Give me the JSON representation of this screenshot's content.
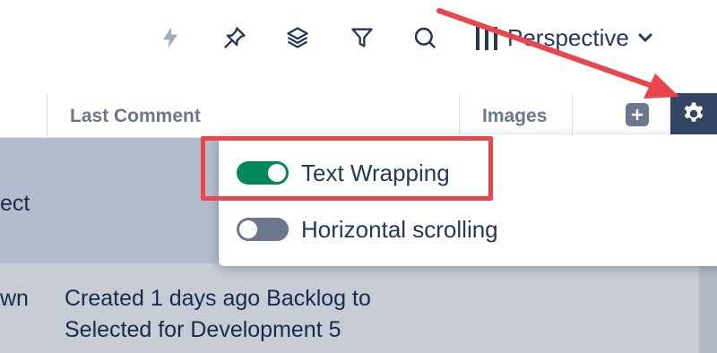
{
  "toolbar": {
    "icons": [
      "lightning-icon",
      "pin-icon",
      "layers-icon",
      "filter-icon",
      "search-icon"
    ],
    "perspective_label": "Perspective"
  },
  "table": {
    "headers": {
      "last_comment": "Last Comment",
      "images": "Images"
    },
    "rows": [
      {
        "left_fragment": "ect",
        "last_comment": ""
      },
      {
        "left_fragment": "wn",
        "last_comment": "Created 1 days ago Backlog to Selected for Development 5"
      }
    ]
  },
  "settings_menu": {
    "options": [
      {
        "label": "Text Wrapping",
        "enabled": true
      },
      {
        "label": "Horizontal scrolling",
        "enabled": false
      }
    ]
  },
  "colors": {
    "toggle_on": "#00875a",
    "toggle_off": "#6b778c",
    "highlight": "#e8464c",
    "gear_bg": "#344563"
  }
}
